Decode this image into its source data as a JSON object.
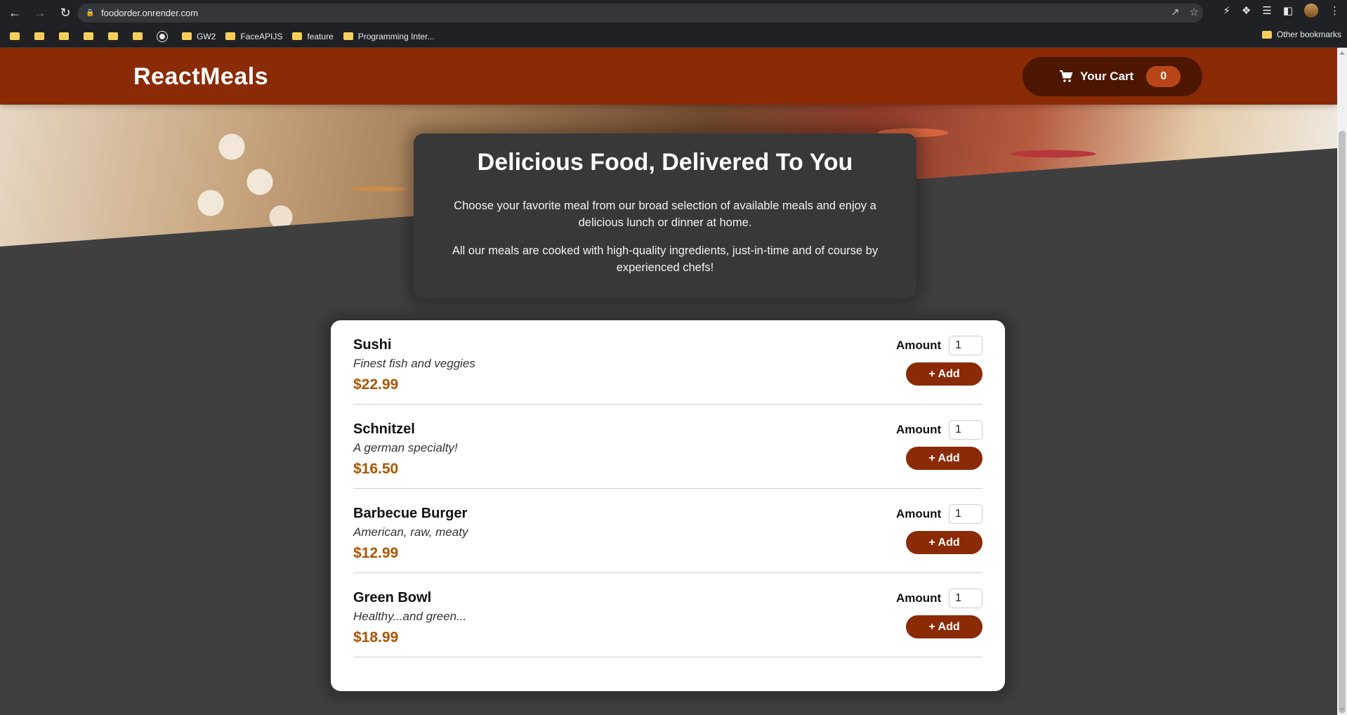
{
  "browser": {
    "url": "foodorder.onrender.com",
    "bookmarks": [
      "GW2",
      "FaceAPIJS",
      "feature",
      "Programming Inter..."
    ],
    "other_bookmarks": "Other bookmarks"
  },
  "header": {
    "brand": "ReactMeals",
    "cart_label": "Your Cart",
    "cart_count": "0"
  },
  "summary": {
    "title": "Delicious Food, Delivered To You",
    "paragraph1": "Choose your favorite meal from our broad selection of available meals and enjoy a delicious lunch or dinner at home.",
    "paragraph2": "All our meals are cooked with high-quality ingredients, just-in-time and of course by experienced chefs!"
  },
  "meals": [
    {
      "name": "Sushi",
      "description": "Finest fish and veggies",
      "price": "$22.99",
      "amount_label": "Amount",
      "amount": "1",
      "add_label": "+ Add"
    },
    {
      "name": "Schnitzel",
      "description": "A german specialty!",
      "price": "$16.50",
      "amount_label": "Amount",
      "amount": "1",
      "add_label": "+ Add"
    },
    {
      "name": "Barbecue Burger",
      "description": "American, raw, meaty",
      "price": "$12.99",
      "amount_label": "Amount",
      "amount": "1",
      "add_label": "+ Add"
    },
    {
      "name": "Green Bowl",
      "description": "Healthy...and green...",
      "price": "$18.99",
      "amount_label": "Amount",
      "amount": "1",
      "add_label": "+ Add"
    }
  ],
  "colors": {
    "header": "#8a2b06",
    "cart_button": "#4d1601",
    "badge": "#b94517",
    "price": "#ad5502",
    "background": "#3f3f3f"
  }
}
